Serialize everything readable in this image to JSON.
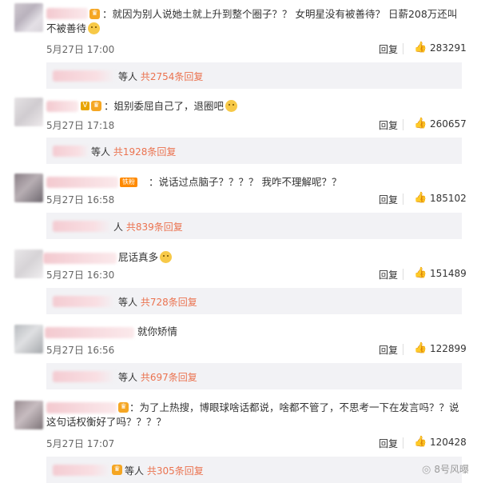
{
  "comments": [
    {
      "text": "：就因为别人说她土就上升到整个圈子？？ 女明星没有被善待？ 日薪208万还叫不被善待",
      "time": "5月27日 17:00",
      "reply_label": "回复",
      "likes": "283291",
      "sub_people": "等人",
      "sub_count": "共2754条回复"
    },
    {
      "text": "：姐别委屈自己了，退圈吧",
      "time": "5月27日 17:18",
      "reply_label": "回复",
      "likes": "260657",
      "sub_people": "等人",
      "sub_count": "共1928条回复"
    },
    {
      "text": "：说话过点脑子？？？？ 我咋不理解呢？？",
      "time": "5月27日 16:58",
      "reply_label": "回复",
      "likes": "185102",
      "sub_people": "人",
      "sub_count": "共839条回复"
    },
    {
      "text": "屁话真多",
      "time": "5月27日 16:30",
      "reply_label": "回复",
      "likes": "151489",
      "sub_people": "等人",
      "sub_count": "共728条回复"
    },
    {
      "text": "就你矫情",
      "time": "5月27日 16:56",
      "reply_label": "回复",
      "likes": "122899",
      "sub_people": "等人",
      "sub_count": "共697条回复"
    },
    {
      "text": "：为了上热搜，博眼球啥话都说，啥都不管了，不思考一下在发言吗？？说这句话权衡好了吗？？？？",
      "time": "5月27日 17:07",
      "reply_label": "回复",
      "likes": "120428",
      "sub_people": "等人",
      "sub_count": "共305条回复"
    }
  ],
  "watermark": "8号风曝",
  "icons": {
    "thumb": "thumbs-up-icon",
    "emoji": "emoji-icon",
    "wechat": "wechat-icon"
  },
  "colors": {
    "link": "#eb7350",
    "subbox": "#f2f2f5"
  }
}
